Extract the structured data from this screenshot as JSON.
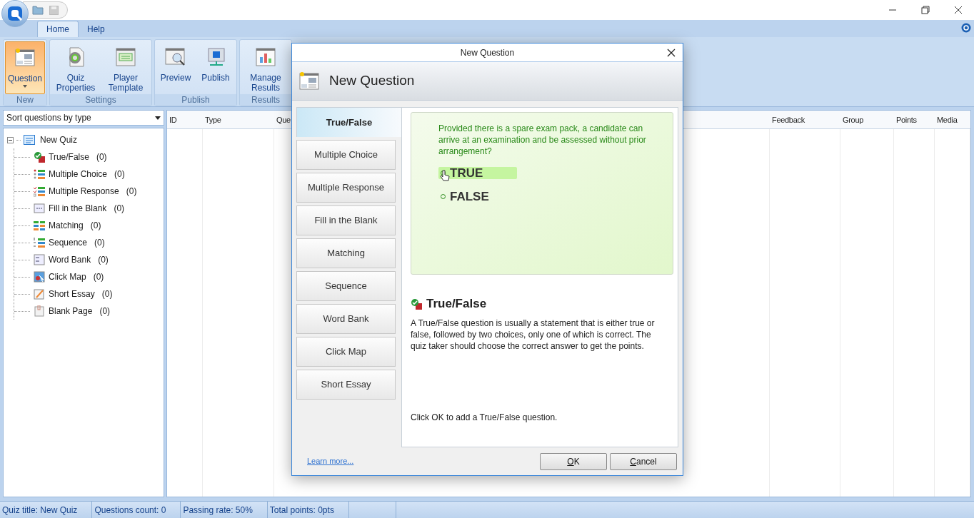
{
  "ribbon_tabs": [
    {
      "label": "Home",
      "selected": true
    },
    {
      "label": "Help",
      "selected": false
    }
  ],
  "ribbon_groups": [
    {
      "label": "New",
      "buttons": [
        {
          "kind": "question",
          "label": "Question",
          "selected": true,
          "dropdown": true
        }
      ]
    },
    {
      "label": "Settings",
      "buttons": [
        {
          "kind": "properties",
          "label": "Quiz Properties",
          "selected": false
        },
        {
          "kind": "template",
          "label": "Player Template",
          "selected": false
        }
      ]
    },
    {
      "label": "Publish",
      "buttons": [
        {
          "kind": "preview",
          "label": "Preview",
          "selected": false
        },
        {
          "kind": "publish",
          "label": "Publish",
          "selected": false
        }
      ]
    },
    {
      "label": "Results",
      "buttons": [
        {
          "kind": "results",
          "label": "Manage Results",
          "selected": false
        }
      ]
    }
  ],
  "sort_dropdown": {
    "value": "Sort questions by type"
  },
  "tree": {
    "label": "New Quiz",
    "expanded": true,
    "children": [
      {
        "kind": "truefalse",
        "label": "True/False",
        "count": "(0)"
      },
      {
        "kind": "choice",
        "label": "Multiple Choice",
        "count": "(0)"
      },
      {
        "kind": "response",
        "label": "Multiple Response",
        "count": "(0)"
      },
      {
        "kind": "blank",
        "label": "Fill in the Blank",
        "count": "(0)"
      },
      {
        "kind": "matching",
        "label": "Matching",
        "count": "(0)"
      },
      {
        "kind": "sequence",
        "label": "Sequence",
        "count": "(0)"
      },
      {
        "kind": "wordbank",
        "label": "Word Bank",
        "count": "(0)"
      },
      {
        "kind": "clickmap",
        "label": "Click Map",
        "count": "(0)"
      },
      {
        "kind": "essay",
        "label": "Short Essay",
        "count": "(0)"
      },
      {
        "kind": "blankpage",
        "label": "Blank Page",
        "count": "(0)"
      }
    ]
  },
  "table": {
    "columns": [
      "ID",
      "Type",
      "Que",
      "Feedback",
      "Group",
      "Points",
      "Media"
    ]
  },
  "status_bar": [
    "Quiz title: New Quiz",
    "Questions count: 0",
    "Passing rate: 50%",
    "Total points: 0pts"
  ],
  "dialog": {
    "title": "New Question",
    "header": "New Question",
    "tabs": [
      {
        "label": "True/False",
        "selected": true
      },
      {
        "label": "Multiple Choice",
        "selected": false
      },
      {
        "label": "Multiple Response",
        "selected": false
      },
      {
        "label": "Fill in the Blank",
        "selected": false
      },
      {
        "label": "Matching",
        "selected": false
      },
      {
        "label": "Sequence",
        "selected": false
      },
      {
        "label": "Word Bank",
        "selected": false
      },
      {
        "label": "Click Map",
        "selected": false
      },
      {
        "label": "Short Essay",
        "selected": false
      }
    ],
    "preview": {
      "question": "Provided there is a spare exam pack, a candidate can arrive at an examination and be assessed without prior arrangement?",
      "options": [
        {
          "label": "TRUE",
          "selected": true
        },
        {
          "label": "FALSE",
          "selected": false
        }
      ]
    },
    "type_title": "True/False",
    "description": "A True/False question is usually a statement that is either true or false, followed by two choices, only one of which is correct. The quiz taker should choose the correct answer to get the points.",
    "hint": "Click OK to add a True/False question.",
    "learn_more": "Learn more...",
    "buttons": [
      "OK",
      "Cancel"
    ]
  }
}
